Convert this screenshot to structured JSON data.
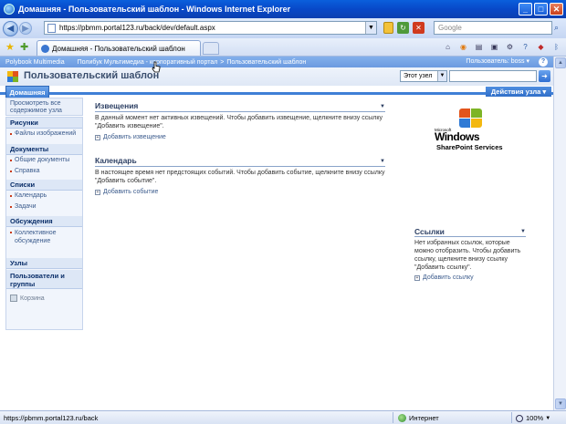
{
  "window": {
    "title": "Домашняя - Пользовательский шаблон - Windows Internet Explorer"
  },
  "browser": {
    "address": "https://pbmm.portal123.ru/back/dev/default.aspx",
    "search_placeholder": "Google",
    "tab_title": "Домашняя - Пользовательский шаблон"
  },
  "sharepoint": {
    "global": {
      "home_link": "Polybook Multimedia",
      "breadcrumb_link": "Полибук Мультимедиа - корпоративный портал",
      "breadcrumb_sep": ">",
      "current": "Пользовательский шаблон",
      "user": "Пользователь: boss",
      "user_caret": "▾",
      "help": "?"
    },
    "site_title": "Пользовательский шаблон",
    "search": {
      "scope": "Этот узел",
      "go": "➜"
    },
    "nav": {
      "home_tab": "Домашняя",
      "site_actions": "Действия узла ▾"
    },
    "quick_launch": {
      "view_all": "Просмотреть все содержимое узла",
      "headings": {
        "pictures": "Рисунки",
        "documents": "Документы",
        "lists": "Списки",
        "discussions": "Обсуждения",
        "sites": "Узлы",
        "people": "Пользователи и группы"
      },
      "items": {
        "image_files": "Файлы изображений",
        "shared_docs": "Общие документы",
        "help": "Справка",
        "calendar": "Календарь",
        "tasks": "Задачи",
        "team_discussion": "Коллективное обсуждение"
      },
      "recycle_bin": "Корзина"
    },
    "webparts": {
      "announcements": {
        "title": "Извещения",
        "body": "В данный момент нет активных извещений. Чтобы добавить извещение, щелкните внизу ссылку \"Добавить извещение\".",
        "add": "Добавить извещение"
      },
      "calendar": {
        "title": "Календарь",
        "body": "В настоящее время нет предстоящих событий. Чтобы добавить событие, щелкните внизу ссылку \"Добавить событие\".",
        "add": "Добавить событие"
      },
      "links": {
        "title": "Ссылки",
        "body": "Нет избранных ссылок, которые можно отобразить. Чтобы добавить ссылку, щелкните внизу ссылку \"Добавить ссылку\".",
        "add": "Добавить ссылку"
      },
      "logo": {
        "microsoft": "Microsoft",
        "windows": "Windows",
        "product": "SharePoint Services"
      }
    }
  },
  "statusbar": {
    "url": "https://pbmm.portal123.ru/back",
    "zone": "Интернет",
    "zoom": "100%"
  },
  "colors": {
    "accent": "#3f7fd6",
    "header_text": "#2c3f63"
  }
}
